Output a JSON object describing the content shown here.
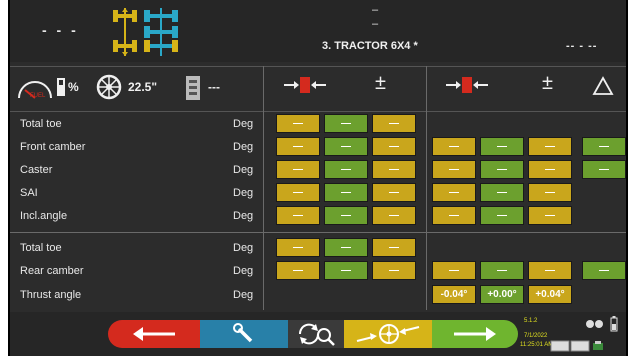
{
  "header": {
    "left_text": "- - -",
    "center_top": "–",
    "center_top2": "–",
    "title": "3. TRACTOR 6X4 *",
    "right_text": "-- - --"
  },
  "infobar": {
    "fuel_label": "%",
    "wheel_size": "22.5\"",
    "spec_value": "---"
  },
  "columns": {
    "front_pm": "±",
    "rear_pm": "±"
  },
  "rows_front": [
    {
      "label": "Total toe",
      "unit": "Deg"
    },
    {
      "label": "Front camber",
      "unit": "Deg"
    },
    {
      "label": "Caster",
      "unit": "Deg"
    },
    {
      "label": "SAI",
      "unit": "Deg"
    },
    {
      "label": "Incl.angle",
      "unit": "Deg"
    }
  ],
  "rows_rear": [
    {
      "label": "Total toe",
      "unit": "Deg"
    },
    {
      "label": "Rear camber",
      "unit": "Deg"
    },
    {
      "label": "Thrust angle",
      "unit": "Deg"
    }
  ],
  "cells": {
    "dash": "—",
    "thrust_a": "-0.04°",
    "thrust_b": "+0.00°",
    "thrust_c": "+0.04°"
  },
  "status": {
    "version": "5.1.2",
    "date": "7/1/2022",
    "time": "11:25:01 AM"
  },
  "colors": {
    "yellow": "#c9a61c",
    "green": "#6ca02e",
    "red": "#d42a1e",
    "blue": "#2880a8"
  }
}
